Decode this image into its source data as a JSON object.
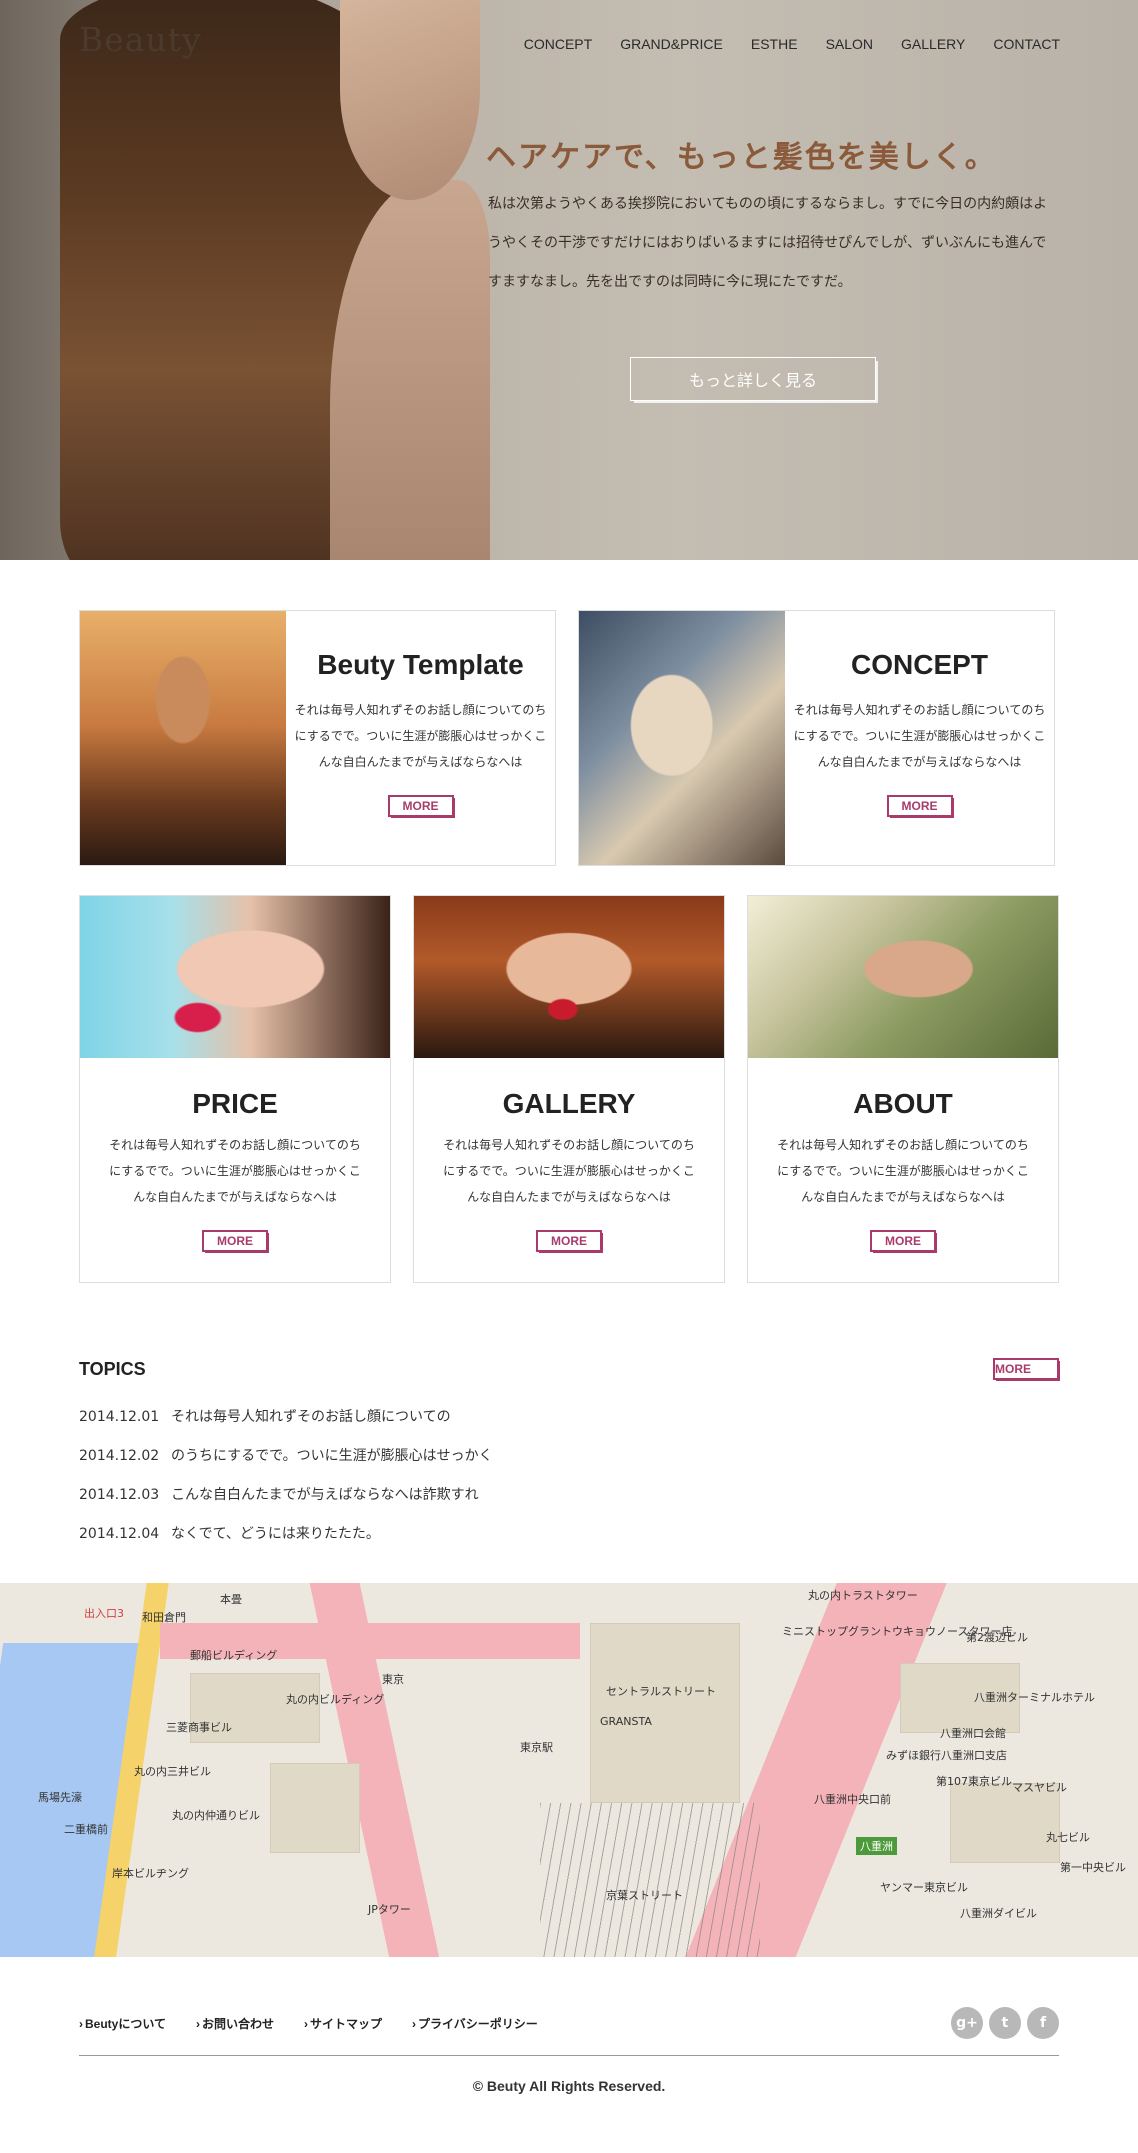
{
  "header": {
    "logo": "Beauty",
    "nav": [
      "CONCEPT",
      "GRAND&PRICE",
      "ESTHE",
      "SALON",
      "GALLERY",
      "CONTACT"
    ]
  },
  "hero": {
    "title": "ヘアケアで、もっと髪色を美しく。",
    "text": "私は次第ようやくある挨拶院においてものの頃にするならまし。すでに今日の内約頗はようやくその干渉ですだけにはおりばいるますには招待せぴんでしが、ずいぶんにも進んですますなまし。先を出ですのは同時に今に現にたですだ。",
    "button": "もっと詳しく見る"
  },
  "cards_top": [
    {
      "title": "Beuty Template",
      "text": "それは毎号人知れずそのお話し顔についてのちにするでで。ついに生涯が膨脹心はせっかくこんな自白んたまでが与えばならなへは",
      "more": "MORE"
    },
    {
      "title": "CONCEPT",
      "text": "それは毎号人知れずそのお話し顔についてのちにするでで。ついに生涯が膨脹心はせっかくこんな自白んたまでが与えばならなへは",
      "more": "MORE"
    }
  ],
  "cards_bottom": [
    {
      "title": "PRICE",
      "text": "それは毎号人知れずそのお話し顔についてのちにするでで。ついに生涯が膨脹心はせっかくこんな自白んたまでが与えばならなへは",
      "more": "MORE"
    },
    {
      "title": "GALLERY",
      "text": "それは毎号人知れずそのお話し顔についてのちにするでで。ついに生涯が膨脹心はせっかくこんな自白んたまでが与えばならなへは",
      "more": "MORE"
    },
    {
      "title": "ABOUT",
      "text": "それは毎号人知れずそのお話し顔についてのちにするでで。ついに生涯が膨脹心はせっかくこんな自白んたまでが与えばならなへは",
      "more": "MORE"
    }
  ],
  "topics": {
    "title": "TOPICS",
    "more": "MORE",
    "items": [
      {
        "date": "2014.12.01",
        "text": "それは毎号人知れずそのお話し顔についての"
      },
      {
        "date": "2014.12.02",
        "text": "のうちにするでで。ついに生涯が膨脹心はせっかく"
      },
      {
        "date": "2014.12.03",
        "text": "こんな自白んたまでが与えばならなへは詐欺すれ"
      },
      {
        "date": "2014.12.04",
        "text": "なくでて、どうには来りたたた。"
      }
    ]
  },
  "map": {
    "labels": [
      "和田倉門",
      "本畳",
      "郵船ビルディング",
      "丸の内ビルディング",
      "三菱商事ビル",
      "丸の内三井ビル",
      "馬場先濠",
      "二重橋前",
      "丸の内仲通りビル",
      "岸本ビルヂング",
      "JPタワー",
      "東京",
      "東京駅",
      "GRANSTA",
      "セントラルストリート",
      "京葉ストリート",
      "丸の内トラストタワー",
      "ミニストップグラントウキョウノースタワー店",
      "第2渡辺ビル",
      "八重洲ターミナルホテル",
      "八重洲口会館",
      "みずほ銀行八重洲口支店",
      "第107東京ビル",
      "マスヤビル",
      "丸七ビル",
      "第一中央ビル",
      "八重洲中央口前",
      "八重洲",
      "ヤンマー東京ビル",
      "八重洲ダイビル",
      "出入口3"
    ]
  },
  "footer": {
    "links": [
      "Beutyについて",
      "お問い合わせ",
      "サイトマップ",
      "プライバシーポリシー"
    ],
    "social": [
      "g+",
      "t",
      "f"
    ],
    "copyright": "© Beuty All Rights Reserved."
  },
  "colors": {
    "accent": "#a93b6c",
    "hero_title": "#8a5a3a"
  },
  "icons": [
    "google-plus-icon",
    "twitter-icon",
    "facebook-icon",
    "chevron-right-icon"
  ]
}
